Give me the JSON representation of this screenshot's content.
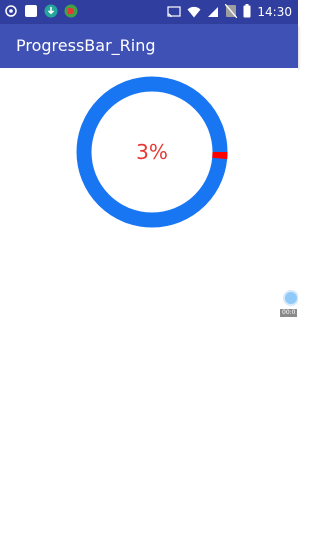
{
  "status_bar": {
    "time": "14:30",
    "left_icons": [
      "notification-icon",
      "square-app-icon",
      "download-icon",
      "app-d-icon"
    ],
    "right_icons": [
      "cast-icon",
      "wifi-icon",
      "signal-icon",
      "no-sim-icon",
      "battery-icon"
    ]
  },
  "app_bar": {
    "title": "ProgressBar_Ring"
  },
  "progress": {
    "label": "3%",
    "value": 0.03,
    "ring_color": "#1976f2",
    "progress_color": "#ff0000",
    "text_color": "#e53935"
  },
  "edge_overlay": {
    "label": "00:0"
  },
  "colors": {
    "status_bar": "#303f9f",
    "app_bar": "#3f51b5"
  }
}
